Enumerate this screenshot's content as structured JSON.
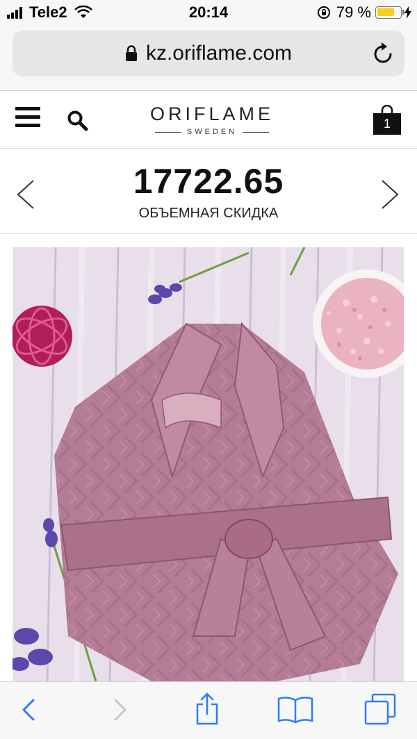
{
  "status_bar": {
    "carrier": "Tele2",
    "time": "20:14",
    "battery_percent": "79 %",
    "battery_level": 0.79
  },
  "browser": {
    "url": "kz.oriflame.com"
  },
  "header": {
    "brand": "ORIFLAME",
    "brand_sub": "SWEDEN",
    "cart_count": "1"
  },
  "promo": {
    "amount": "17722.65",
    "label": "ОБЪЕМНАЯ СКИДКА"
  },
  "product": {
    "image_icon": "bathrobe-image",
    "robe_color": "#b47c95",
    "background_color": "#e6dde9"
  },
  "toolbar": {
    "icons": [
      "back-icon",
      "forward-icon",
      "share-icon",
      "bookmarks-icon",
      "tabs-icon"
    ],
    "accent_color": "#2d7cf6"
  }
}
